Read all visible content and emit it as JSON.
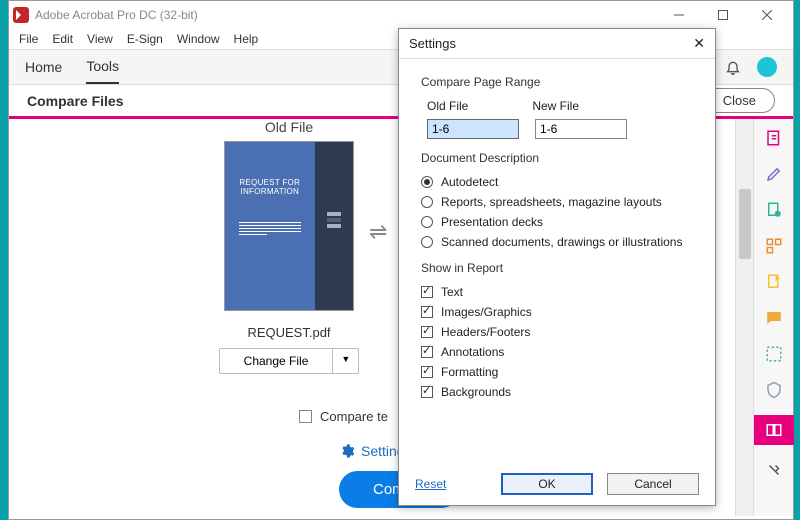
{
  "titlebar": {
    "title": "Adobe Acrobat Pro DC (32-bit)"
  },
  "menubar": [
    "File",
    "Edit",
    "View",
    "E-Sign",
    "Window",
    "Help"
  ],
  "topbar": {
    "tabs": [
      {
        "label": "Home",
        "active": false
      },
      {
        "label": "Tools",
        "active": true
      }
    ]
  },
  "sub_header": {
    "title": "Compare Files",
    "close": "Close"
  },
  "main": {
    "old_file_label": "Old File",
    "doc_title1": "REQUEST FOR",
    "doc_title2": "INFORMATION",
    "filename": "REQUEST.pdf",
    "change_file": "Change File",
    "swap_glyph": "⇌",
    "compare_text_only": "Compare te",
    "settings_link": "Setting",
    "compare_btn": "Compar"
  },
  "dialog": {
    "title": "Settings",
    "compare_range_label": "Compare Page Range",
    "old_file_label": "Old File",
    "new_file_label": "New File",
    "old_range": "1-6",
    "new_range": "1-6",
    "doc_desc_label": "Document Description",
    "doc_desc_options": [
      {
        "label": "Autodetect",
        "checked": true
      },
      {
        "label": "Reports, spreadsheets, magazine layouts",
        "checked": false
      },
      {
        "label": "Presentation decks",
        "checked": false
      },
      {
        "label": "Scanned documents, drawings or illustrations",
        "checked": false
      }
    ],
    "show_label": "Show in Report",
    "show_options": [
      {
        "label": "Text",
        "checked": true
      },
      {
        "label": "Images/Graphics",
        "checked": true
      },
      {
        "label": "Headers/Footers",
        "checked": true
      },
      {
        "label": "Annotations",
        "checked": true
      },
      {
        "label": "Formatting",
        "checked": true
      },
      {
        "label": "Backgrounds",
        "checked": true
      }
    ],
    "reset": "Reset",
    "ok": "OK",
    "cancel": "Cancel"
  },
  "right_rail": [
    {
      "name": "create-pdf-icon",
      "color": "#e6007e"
    },
    {
      "name": "edit-icon",
      "color": "#8a63d2"
    },
    {
      "name": "export-icon",
      "color": "#2db59a"
    },
    {
      "name": "organize-icon",
      "color": "#f08c2e"
    },
    {
      "name": "stamp-icon",
      "color": "#f4c430"
    },
    {
      "name": "comment-icon",
      "color": "#f2a93c"
    },
    {
      "name": "redact-icon",
      "color": "#48b96f"
    },
    {
      "name": "protect-icon",
      "color": "#8aa0c0"
    },
    {
      "name": "compare-files-icon",
      "color": "#e6007e",
      "active": true
    },
    {
      "name": "more-tools-icon",
      "color": "#555"
    }
  ]
}
